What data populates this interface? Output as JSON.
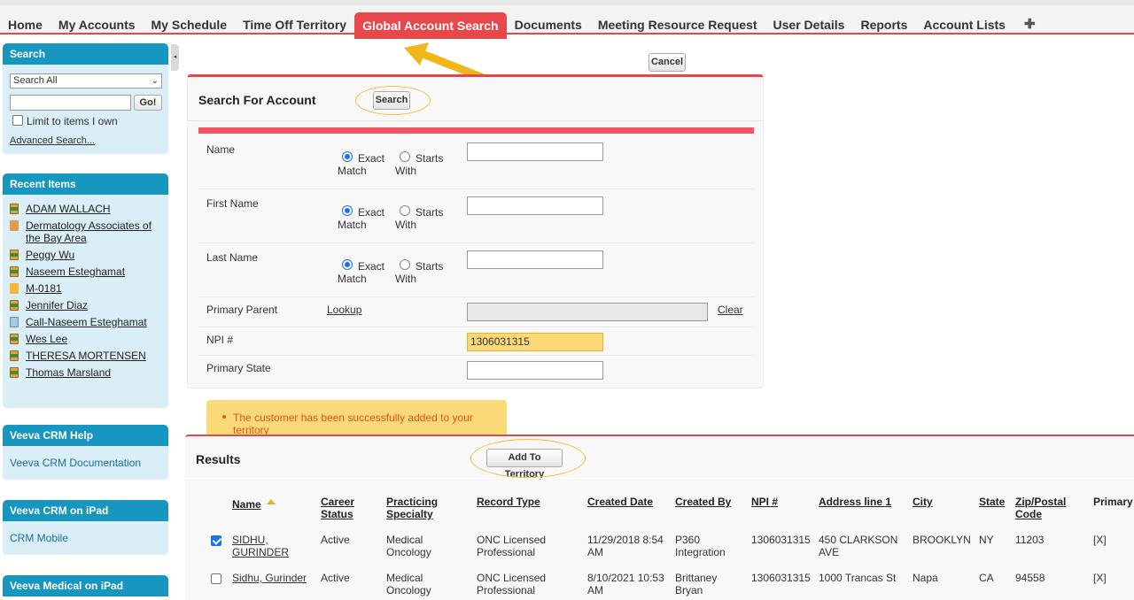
{
  "nav": {
    "tabs": [
      {
        "label": "Home"
      },
      {
        "label": "My Accounts"
      },
      {
        "label": "My Schedule"
      },
      {
        "label": "Time Off Territory"
      },
      {
        "label": "Global Account Search",
        "active": true
      },
      {
        "label": "Documents"
      },
      {
        "label": "Meeting Resource Request"
      },
      {
        "label": "User Details"
      },
      {
        "label": "Reports"
      },
      {
        "label": "Account Lists"
      }
    ],
    "plus": "✚"
  },
  "sidebar": {
    "search": {
      "title": "Search",
      "scope_select": "Search All",
      "go_label": "Go!",
      "limit_label": "Limit to items I own",
      "advanced_label": "Advanced Search..."
    },
    "recent": {
      "title": "Recent Items",
      "items": [
        {
          "label": "ADAM WALLACH",
          "icon": "person-icon"
        },
        {
          "label": "Dermatology Associates of the Bay Area",
          "icon": "organization-icon"
        },
        {
          "label": "Peggy Wu",
          "icon": "person-icon"
        },
        {
          "label": "Naseem Esteghamat",
          "icon": "person-icon"
        },
        {
          "label": "M-0181",
          "icon": "medical-event-icon"
        },
        {
          "label": "Jennifer Diaz",
          "icon": "person-icon"
        },
        {
          "label": "Call-Naseem Esteghamat",
          "icon": "call-icon"
        },
        {
          "label": "Wes Lee",
          "icon": "person-icon"
        },
        {
          "label": "THERESA MORTENSEN",
          "icon": "person-icon"
        },
        {
          "label": "Thomas Marsland",
          "icon": "person-icon"
        }
      ]
    },
    "help": {
      "title": "Veeva CRM Help",
      "link": "Veeva CRM Documentation"
    },
    "ipad": {
      "title": "Veeva CRM on iPad",
      "link": "CRM Mobile"
    },
    "medical": {
      "title": "Veeva Medical on iPad"
    }
  },
  "actions": {
    "cancel_label": "Cancel"
  },
  "search_panel": {
    "title": "Search For Account",
    "search_label": "Search",
    "fields": {
      "name": {
        "label": "Name",
        "exact": "Exact Match",
        "starts": "Starts With",
        "value": ""
      },
      "first_name": {
        "label": "First Name",
        "exact": "Exact Match",
        "starts": "Starts With",
        "value": ""
      },
      "last_name": {
        "label": "Last Name",
        "exact": "Exact Match",
        "starts": "Starts With",
        "value": ""
      },
      "primary_parent": {
        "label": "Primary Parent",
        "lookup": "Lookup",
        "clear": "Clear",
        "value": ""
      },
      "npi": {
        "label": "NPI #",
        "value": "1306031315"
      },
      "primary_state": {
        "label": "Primary State",
        "value": ""
      }
    },
    "exact_word": "Exact",
    "match_word": "Match",
    "starts_word": "Starts",
    "with_word": "With"
  },
  "toast": {
    "message": "The customer has been successfully added to your territory"
  },
  "results": {
    "title": "Results",
    "add_label": "Add To Territory",
    "columns": {
      "name": "Name",
      "career1": "Career",
      "career2": "Status",
      "spec1": "Practicing",
      "spec2": "Specialty",
      "record_type": "Record Type",
      "created_date": "Created Date",
      "created_by": "Created By",
      "npi": "NPI #",
      "address": "Address line 1",
      "city": "City",
      "state": "State",
      "zip1": "Zip/Postal",
      "zip2": "Code",
      "primary": "Primary"
    },
    "rows": [
      {
        "checked": true,
        "name1": "SIDHU,",
        "name2": "GURINDER",
        "career": "Active",
        "spec1": "Medical",
        "spec2": "Oncology",
        "rt1": "ONC Licensed",
        "rt2": "Professional",
        "date1": "11/29/2018 8:54",
        "date2": "AM",
        "by1": "P360",
        "by2": "Integration",
        "npi": "1306031315",
        "addr1": "450 CLARKSON",
        "addr2": "AVE",
        "city": "BROOKLYN",
        "state": "NY",
        "zip": "11203",
        "primary": "[X]"
      },
      {
        "checked": false,
        "name1": "Sidhu, Gurinder",
        "name2": "",
        "career": "Active",
        "spec1": "Medical",
        "spec2": "Oncology",
        "rt1": "ONC Licensed",
        "rt2": "Professional",
        "date1": "8/10/2021 10:53",
        "date2": "AM",
        "by1": "Brittaney",
        "by2": "Bryan",
        "npi": "1306031315",
        "addr1": "1000 Trancas St",
        "addr2": "",
        "city": "Napa",
        "state": "CA",
        "zip": "94558",
        "primary": "[X]"
      }
    ]
  },
  "colors": {
    "accent_red": "#e8474c",
    "sidebar_blue": "#1797c0",
    "highlight_yellow": "#fbd978"
  }
}
